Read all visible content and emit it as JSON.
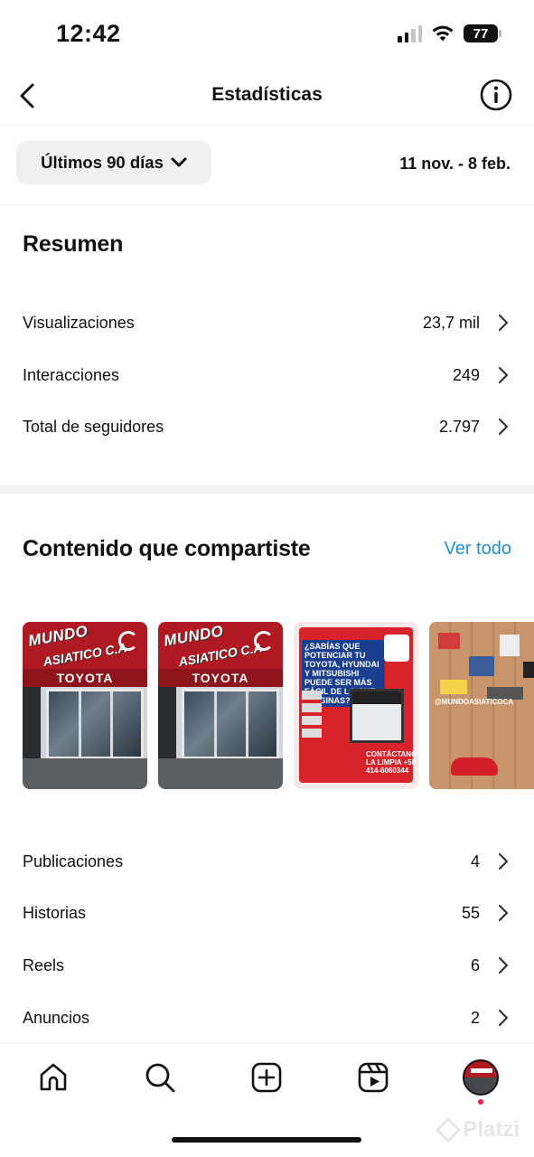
{
  "status_bar": {
    "time": "12:42",
    "battery": "77",
    "icons": [
      "cellular-signal-icon",
      "wifi-icon",
      "battery-icon"
    ]
  },
  "header": {
    "title": "Estadísticas",
    "back_icon": "chevron-left-icon",
    "info_icon": "info-icon"
  },
  "filter": {
    "period_label": "Últimos 90 días",
    "date_range": "11 nov. - 8 feb."
  },
  "summary": {
    "title": "Resumen",
    "rows": [
      {
        "label": "Visualizaciones",
        "value": "23,7 mil"
      },
      {
        "label": "Interacciones",
        "value": "249"
      },
      {
        "label": "Total de seguidores",
        "value": "2.797"
      }
    ]
  },
  "content": {
    "title": "Contenido que compartiste",
    "see_all": "Ver todo",
    "thumbnails": [
      {
        "sign": "MUNDO",
        "sign_sub": "ASIATICO C.A",
        "band": "TOYOTA"
      },
      {
        "sign": "MUNDO",
        "sign_sub": "ASIATICO C.A",
        "band": "TOYOTA"
      },
      {
        "headline": "¿SABÍAS QUE POTENCIAR TU TOYOTA, HYUNDAI Y MITSUBISHI PUEDE SER MÁS FÁCIL DE LO QUE IMAGINAS?",
        "contact": "CONTÁCTANOS LA LIMPIA +58 414-6060344"
      },
      {
        "tag": "@MUNDOASIATICOCA"
      }
    ],
    "rows": [
      {
        "label": "Publicaciones",
        "value": "4"
      },
      {
        "label": "Historias",
        "value": "55"
      },
      {
        "label": "Reels",
        "value": "6"
      },
      {
        "label": "Anuncios",
        "value": "2"
      }
    ]
  },
  "bottom_nav": {
    "items": [
      "home-icon",
      "search-icon",
      "create-icon",
      "reels-icon",
      "profile-avatar"
    ]
  },
  "watermark": "Platzi",
  "colors": {
    "accent_link": "#1e90d6",
    "notification_dot": "#ff1a45",
    "filter_bg": "#eff0f2"
  }
}
